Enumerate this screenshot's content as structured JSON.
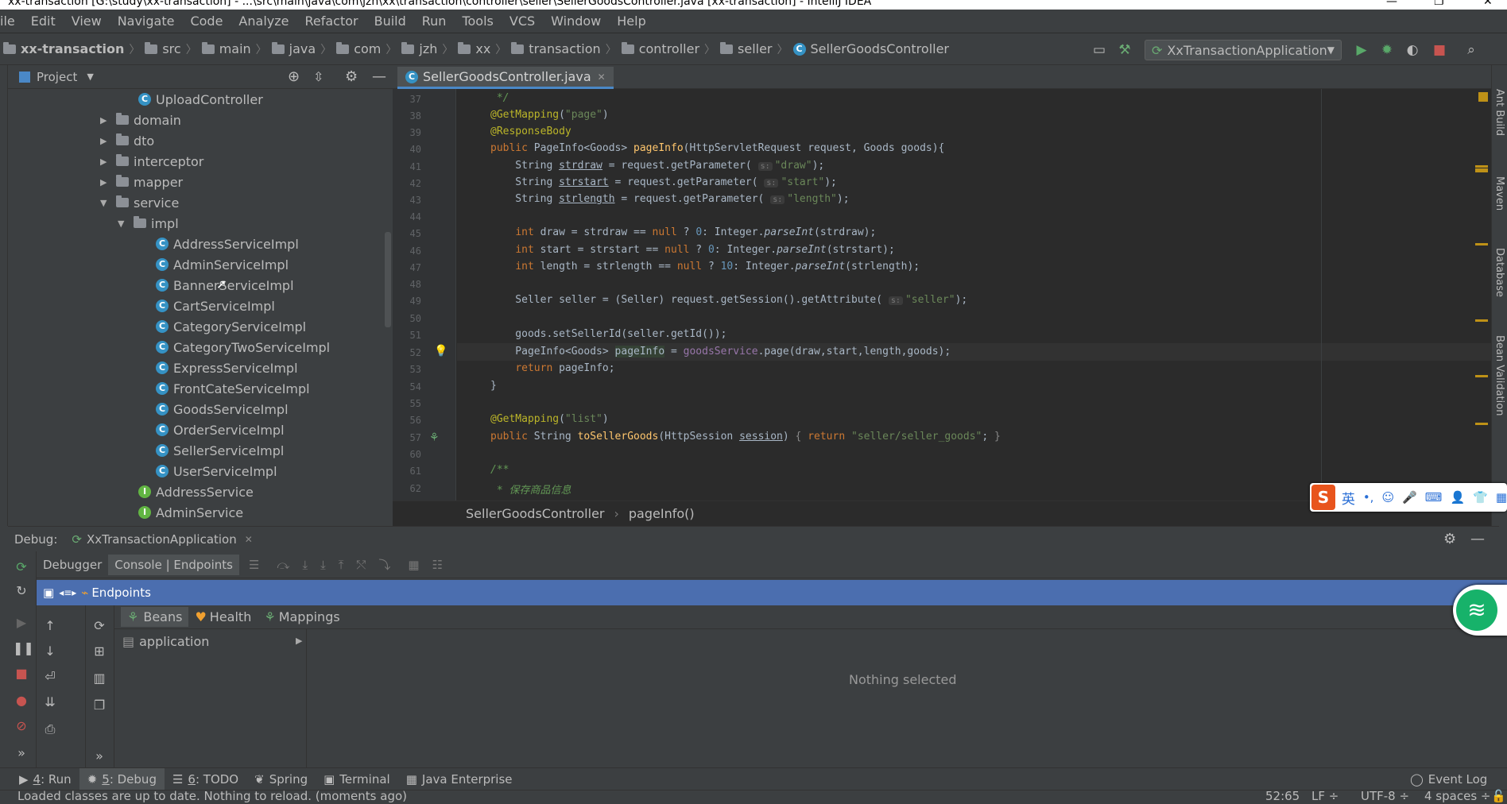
{
  "window": {
    "title": "xx-transaction [G:\\study\\xx-transaction] - ...\\src\\main\\java\\com\\jzh\\xx\\transaction\\controller\\seller\\SellerGoodsController.java [xx-transaction] - IntelliJ IDEA",
    "controls": [
      "—",
      "❐",
      "✕"
    ]
  },
  "menu": [
    "ile",
    "Edit",
    "View",
    "Navigate",
    "Code",
    "Analyze",
    "Refactor",
    "Build",
    "Run",
    "Tools",
    "VCS",
    "Window",
    "Help"
  ],
  "breadcrumb": {
    "project": "xx-transaction",
    "folders": [
      "src",
      "main",
      "java",
      "com",
      "jzh",
      "xx",
      "transaction",
      "controller",
      "seller"
    ],
    "file": "SellerGoodsController"
  },
  "run_config": {
    "label": "XxTransactionApplication"
  },
  "project_panel": {
    "title": "Project",
    "tree": [
      {
        "label": "UploadController",
        "type": "class",
        "arrow": ""
      },
      {
        "label": "domain",
        "type": "folder",
        "arrow": "▶"
      },
      {
        "label": "dto",
        "type": "folder",
        "arrow": "▶"
      },
      {
        "label": "interceptor",
        "type": "folder",
        "arrow": "▶"
      },
      {
        "label": "mapper",
        "type": "folder",
        "arrow": "▶"
      },
      {
        "label": "service",
        "type": "folder",
        "arrow": "▼"
      },
      {
        "label": "impl",
        "type": "folder",
        "arrow": "▼"
      },
      {
        "label": "AddressServiceImpl",
        "type": "class",
        "arrow": ""
      },
      {
        "label": "AdminServiceImpl",
        "type": "class",
        "arrow": ""
      },
      {
        "label": "BannerServiceImpl",
        "type": "class",
        "arrow": ""
      },
      {
        "label": "CartServiceImpl",
        "type": "class",
        "arrow": ""
      },
      {
        "label": "CategoryServiceImpl",
        "type": "class",
        "arrow": ""
      },
      {
        "label": "CategoryTwoServiceImpl",
        "type": "class",
        "arrow": ""
      },
      {
        "label": "ExpressServiceImpl",
        "type": "class",
        "arrow": ""
      },
      {
        "label": "FrontCateServiceImpl",
        "type": "class",
        "arrow": ""
      },
      {
        "label": "GoodsServiceImpl",
        "type": "class",
        "arrow": ""
      },
      {
        "label": "OrderServiceImpl",
        "type": "class",
        "arrow": ""
      },
      {
        "label": "SellerServiceImpl",
        "type": "class",
        "arrow": ""
      },
      {
        "label": "UserServiceImpl",
        "type": "class",
        "arrow": ""
      },
      {
        "label": "AddressService",
        "type": "interface",
        "arrow": ""
      },
      {
        "label": "AdminService",
        "type": "interface",
        "arrow": ""
      }
    ]
  },
  "editor": {
    "tab": "SellerGoodsController.java",
    "line_numbers": [
      "37",
      "38",
      "39",
      "40",
      "41",
      "42",
      "43",
      "44",
      "45",
      "46",
      "47",
      "48",
      "49",
      "50",
      "51",
      "52",
      "53",
      "54",
      "55",
      "56",
      "57",
      "60",
      "61",
      "62"
    ],
    "breadcrumb": [
      "SellerGoodsController",
      "pageInfo()"
    ]
  },
  "right_strip": [
    "Ant Build",
    "Maven",
    "Database",
    "Bean Validation"
  ],
  "debug": {
    "label": "Debug:",
    "session": "XxTransactionApplication",
    "tabs": [
      "Debugger",
      "Console | Endpoints"
    ],
    "endpoints_label": "Endpoints",
    "bean_tabs": [
      "Beans",
      "Health",
      "Mappings"
    ],
    "app_item": "application",
    "empty_text": "Nothing selected"
  },
  "tool_windows": [
    {
      "key": "4",
      "label": ": Run"
    },
    {
      "key": "5",
      "label": ": Debug"
    },
    {
      "key": "6",
      "label": ": TODO"
    },
    {
      "key": "",
      "label": "Spring"
    },
    {
      "key": "",
      "label": "Terminal"
    },
    {
      "key": "",
      "label": "Java Enterprise"
    }
  ],
  "event_log": "Event Log",
  "status": {
    "message": "Loaded classes are up to date. Nothing to reload. (moments ago)",
    "position": "52:65",
    "line_sep": "LF ÷",
    "encoding": "UTF-8 ÷",
    "indent": "4 spaces ÷"
  },
  "ime": {
    "lang": "英"
  },
  "colors": {
    "accent": "#4b6eaf",
    "bg": "#3c3f41",
    "editor_bg": "#2b2b2b",
    "keyword": "#cc7832",
    "string": "#6a8759"
  }
}
